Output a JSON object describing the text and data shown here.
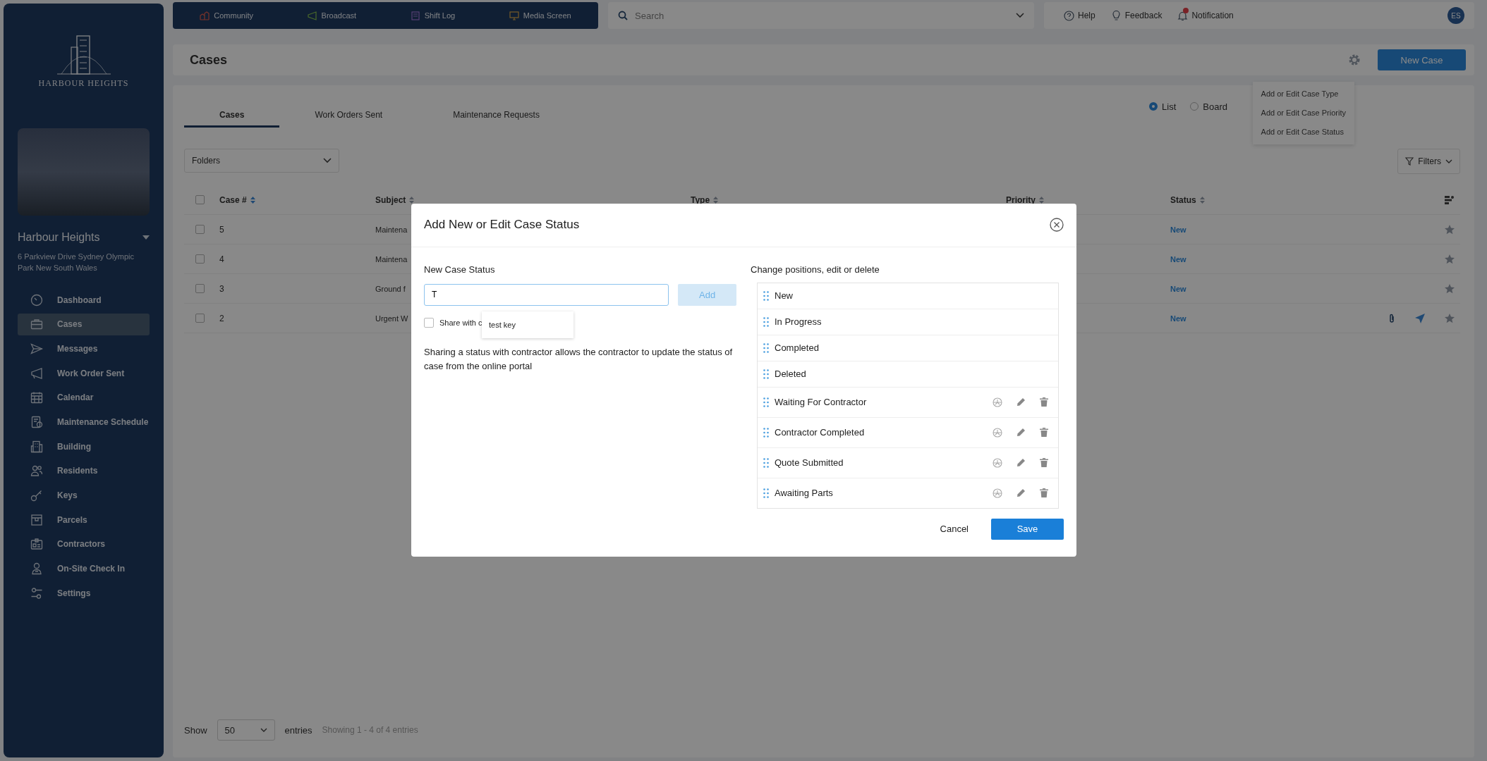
{
  "sidebar": {
    "logo_text": "HARBOUR HEIGHTS",
    "property": {
      "name": "Harbour Heights",
      "address": "6 Parkview Drive Sydney Olympic Park New South Wales"
    },
    "nav": [
      {
        "label": "Dashboard",
        "selected": false
      },
      {
        "label": "Cases",
        "selected": true
      },
      {
        "label": "Messages",
        "selected": false
      },
      {
        "label": "Work Order Sent",
        "selected": false
      },
      {
        "label": "Calendar",
        "selected": false
      },
      {
        "label": "Maintenance Schedule",
        "selected": false
      },
      {
        "label": "Building",
        "selected": false
      },
      {
        "label": "Residents",
        "selected": false
      },
      {
        "label": "Keys",
        "selected": false
      },
      {
        "label": "Parcels",
        "selected": false
      },
      {
        "label": "Contractors",
        "selected": false
      },
      {
        "label": "On-Site Check In",
        "selected": false
      },
      {
        "label": "Settings",
        "selected": false
      }
    ]
  },
  "quick_links": [
    {
      "label": "Community"
    },
    {
      "label": "Broadcast"
    },
    {
      "label": "Shift Log"
    },
    {
      "label": "Media Screen"
    }
  ],
  "search": {
    "placeholder": "Search"
  },
  "header_actions": [
    {
      "label": "Help",
      "badge": false
    },
    {
      "label": "Feedback",
      "badge": false
    },
    {
      "label": "Notification",
      "badge": true
    }
  ],
  "user": {
    "initials": "ES"
  },
  "page": {
    "title": "Cases",
    "new_button": "New Case",
    "settings_menu": [
      "Add or Edit Case Type",
      "Add or Edit Case Priority",
      "Add or Edit Case Status"
    ]
  },
  "tabs": [
    {
      "label": "Cases",
      "selected": true
    },
    {
      "label": "Work Orders Sent",
      "selected": false
    },
    {
      "label": "Maintenance Requests",
      "selected": false
    }
  ],
  "view_options": [
    {
      "label": "List",
      "selected": true
    },
    {
      "label": "Board",
      "selected": false
    }
  ],
  "folders": {
    "label": "Folders"
  },
  "filters": {
    "label": "Filters"
  },
  "table": {
    "columns": [
      "Case #",
      "Subject",
      "Type",
      "Priority",
      "Status"
    ],
    "select_all_checked": false,
    "rows": [
      {
        "checked": false,
        "case": "5",
        "subject": "Maintena",
        "status": "New",
        "attachment": false,
        "sent": false
      },
      {
        "checked": false,
        "case": "4",
        "subject": "Maintena",
        "status": "New",
        "attachment": false,
        "sent": false
      },
      {
        "checked": false,
        "case": "3",
        "subject": "Ground f",
        "status": "New",
        "attachment": false,
        "sent": false
      },
      {
        "checked": false,
        "case": "2",
        "subject": "Urgent W",
        "status": "New",
        "attachment": true,
        "sent": true
      }
    ]
  },
  "pagination": {
    "show": "Show",
    "page_size": "50",
    "entries": "entries",
    "summary": "Showing 1 - 4 of 4 entries"
  },
  "modal": {
    "title": "Add New or Edit Case Status",
    "field_label": "New Case Status",
    "value": "T",
    "add_button": {
      "label": "Add",
      "disabled": true
    },
    "share": {
      "label": "Share with c",
      "checked": false
    },
    "suggestion": "test key",
    "help": "Sharing a status with contractor allows the contractor to update the status of case from the online portal",
    "list_label": "Change positions, edit or delete",
    "statuses": [
      {
        "name": "New",
        "editable": false
      },
      {
        "name": "In Progress",
        "editable": false
      },
      {
        "name": "Completed",
        "editable": false
      },
      {
        "name": "Deleted",
        "editable": false
      },
      {
        "name": "Waiting For Contractor",
        "editable": true
      },
      {
        "name": "Contractor Completed",
        "editable": true
      },
      {
        "name": "Quote Submitted",
        "editable": true
      },
      {
        "name": "Awaiting Parts",
        "editable": true
      }
    ],
    "buttons": {
      "cancel": "Cancel",
      "save": "Save"
    }
  }
}
